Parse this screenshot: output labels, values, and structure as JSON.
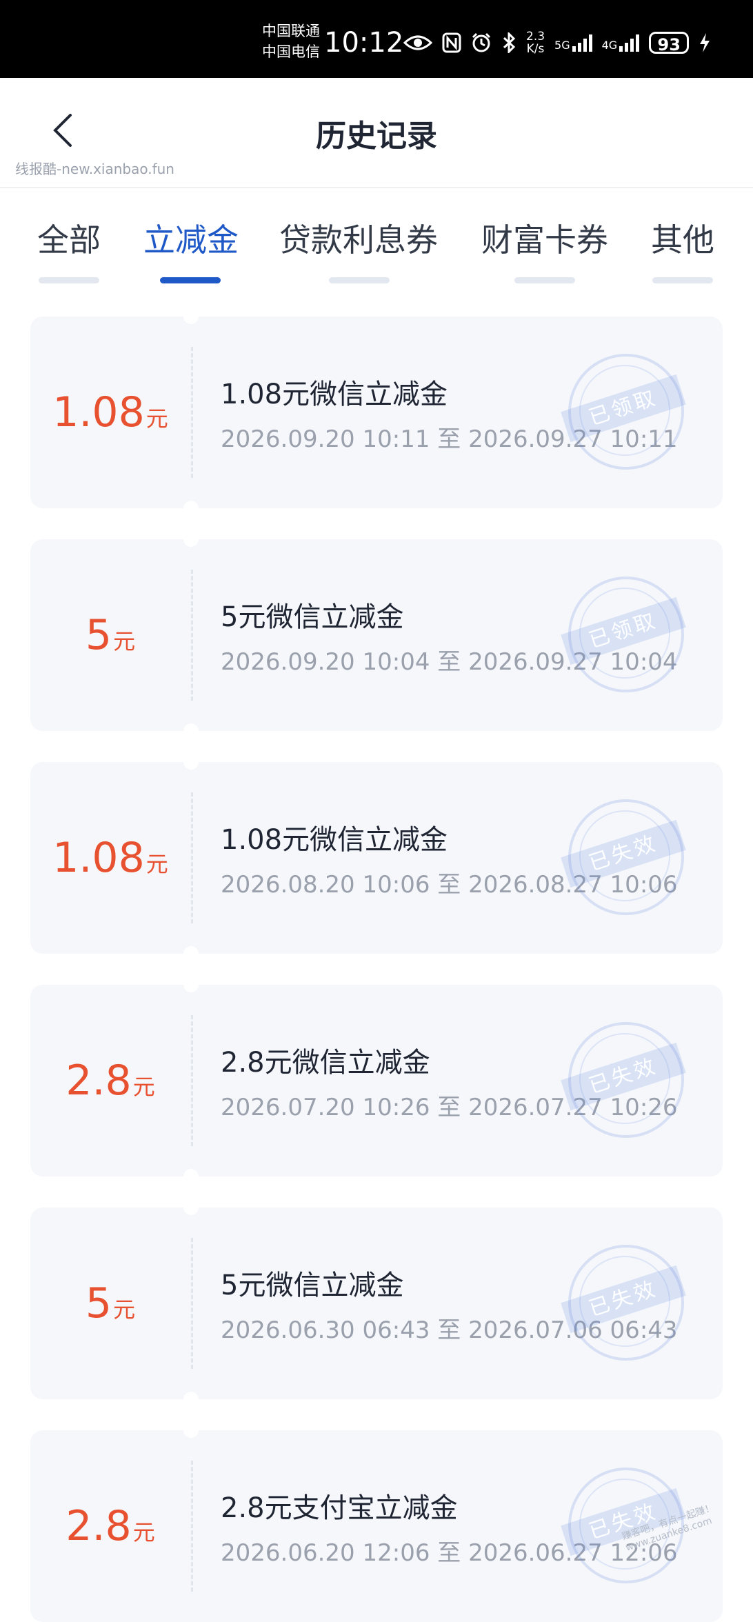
{
  "status_bar": {
    "carrier1": "中国联通",
    "carrier2": "中国电信",
    "time": "10:12",
    "net_speed_value": "2.3",
    "net_speed_unit": "K/s",
    "net1": "5G",
    "net2": "4G",
    "battery": "93"
  },
  "header": {
    "title": "历史记录",
    "watermark": "线报酷-new.xianbao.fun"
  },
  "tabs": [
    {
      "label": "全部"
    },
    {
      "label": "立减金"
    },
    {
      "label": "贷款利息券"
    },
    {
      "label": "财富卡券"
    },
    {
      "label": "其他"
    }
  ],
  "active_tab": "立减金",
  "cards": [
    {
      "amount": "1.08",
      "unit": "元",
      "title": "1.08元微信立减金",
      "period": "2026.09.20 10:11 至 2026.09.27 10:11",
      "status": "已领取"
    },
    {
      "amount": "5",
      "unit": "元",
      "title": "5元微信立减金",
      "period": "2026.09.20 10:04 至 2026.09.27 10:04",
      "status": "已领取"
    },
    {
      "amount": "1.08",
      "unit": "元",
      "title": "1.08元微信立减金",
      "period": "2026.08.20 10:06 至 2026.08.27 10:06",
      "status": "已失效"
    },
    {
      "amount": "2.8",
      "unit": "元",
      "title": "2.8元微信立减金",
      "period": "2026.07.20 10:26 至 2026.07.27 10:26",
      "status": "已失效"
    },
    {
      "amount": "5",
      "unit": "元",
      "title": "5元微信立减金",
      "period": "2026.06.30 06:43 至 2026.07.06 06:43",
      "status": "已失效"
    },
    {
      "amount": "2.8",
      "unit": "元",
      "title": "2.8元支付宝立减金",
      "period": "2026.06.20 12:06 至 2026.06.27 12:06",
      "status": "已失效"
    }
  ],
  "footer_watermark": "赚客吧，有点一起赚！ www.zuanke8.com",
  "colors": {
    "accent": "#1f58c7",
    "amount": "#e8512f",
    "card_bg": "#f5f7fb"
  }
}
